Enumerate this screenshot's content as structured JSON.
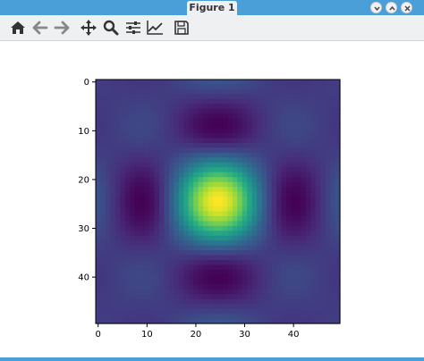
{
  "window": {
    "title": "Figure 1",
    "colors": {
      "titlebar": "#4a9fd8",
      "toolbar": "#eef0f1",
      "icon": "#333333"
    }
  },
  "toolbar": {
    "buttons": [
      {
        "name": "home",
        "icon": "home-icon"
      },
      {
        "name": "back",
        "icon": "arrow-left-icon"
      },
      {
        "name": "forward",
        "icon": "arrow-right-icon"
      },
      {
        "name": "pan",
        "icon": "move-icon"
      },
      {
        "name": "zoom",
        "icon": "magnifier-icon"
      },
      {
        "name": "configure-subplots",
        "icon": "sliders-icon"
      },
      {
        "name": "edit-axes",
        "icon": "line-chart-icon"
      },
      {
        "name": "save",
        "icon": "floppy-disk-icon"
      }
    ]
  },
  "chart_data": {
    "type": "heatmap",
    "colormap": "viridis",
    "shape": [
      50,
      50
    ],
    "function": "product of two sinc profiles centered at (24.5, 24.5)",
    "center": [
      24.5,
      24.5
    ],
    "lobe_period": 11,
    "value_range": [
      -0.22,
      1.0
    ],
    "xlim": [
      -0.5,
      49.5
    ],
    "ylim": [
      49.5,
      -0.5
    ],
    "xticks": [
      0,
      10,
      20,
      30,
      40
    ],
    "yticks": [
      0,
      10,
      20,
      30,
      40
    ],
    "xtick_labels": [
      "0",
      "10",
      "20",
      "30",
      "40"
    ],
    "ytick_labels": [
      "0",
      "10",
      "20",
      "30",
      "40"
    ],
    "title": "",
    "xlabel": "",
    "ylabel": ""
  }
}
